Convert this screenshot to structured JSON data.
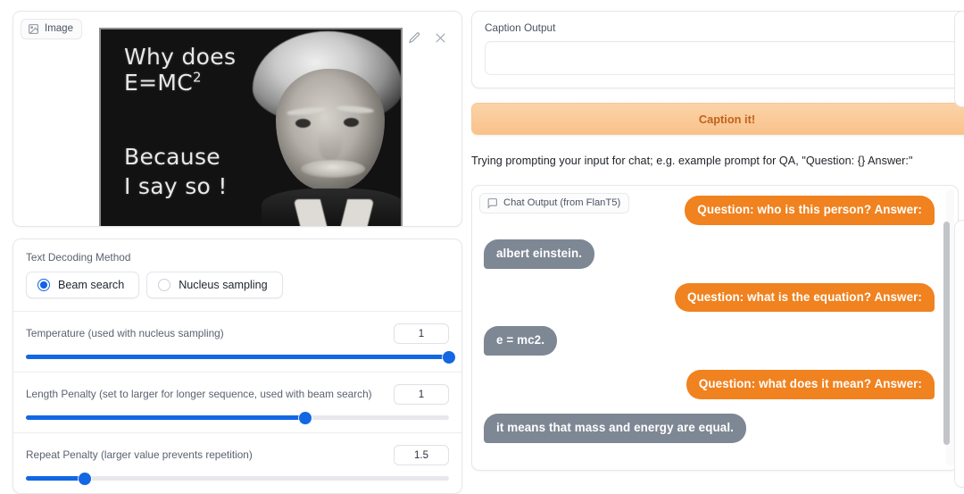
{
  "image_panel": {
    "tag_label": "Image",
    "tag_icon": "image-icon",
    "edit_icon": "pencil-icon",
    "close_icon": "close-icon",
    "meme": {
      "line1": "Why does",
      "line2": "E=MC",
      "line2_sup": "2",
      "line3": "Because",
      "line4": "I say so !",
      "subject": "albert-einstein-photo",
      "background_color": "#121212",
      "text_color": "#e8e8e8"
    }
  },
  "controls": {
    "decoding_label": "Text Decoding Method",
    "options": [
      {
        "label": "Beam search",
        "selected": true
      },
      {
        "label": "Nucleus sampling",
        "selected": false
      }
    ],
    "sliders": [
      {
        "label": "Temperature (used with nucleus sampling)",
        "value": "1",
        "percent": 100
      },
      {
        "label": "Length Penalty (set to larger for longer sequence, used with beam search)",
        "value": "1",
        "percent": 66
      },
      {
        "label": "Repeat Penalty (larger value prevents repetition)",
        "value": "1.5",
        "percent": 14
      }
    ],
    "accent_color": "#1367e3"
  },
  "caption": {
    "label": "Caption Output",
    "value": "",
    "placeholder": "",
    "button_label": "Caption it!",
    "button_color": "#f9c28c",
    "button_text_color": "#c2621b"
  },
  "hint": {
    "text": "Trying prompting your input for chat; e.g. example prompt for QA, \"Question: {} Answer:\""
  },
  "chat": {
    "tag_label": "Chat Output (from FlanT5)",
    "tag_icon": "chat-bubble-icon",
    "user_color": "#f0821f",
    "bot_color": "#7e8794",
    "messages": [
      {
        "role": "user",
        "text": "Question: who is this person? Answer:"
      },
      {
        "role": "bot",
        "text": "albert einstein."
      },
      {
        "role": "user",
        "text": "Question: what is the equation? Answer:"
      },
      {
        "role": "bot",
        "text": "e = mc2."
      },
      {
        "role": "user",
        "text": "Question: what does it mean? Answer:"
      },
      {
        "role": "bot",
        "text": "it means that mass and energy are equal."
      }
    ]
  }
}
